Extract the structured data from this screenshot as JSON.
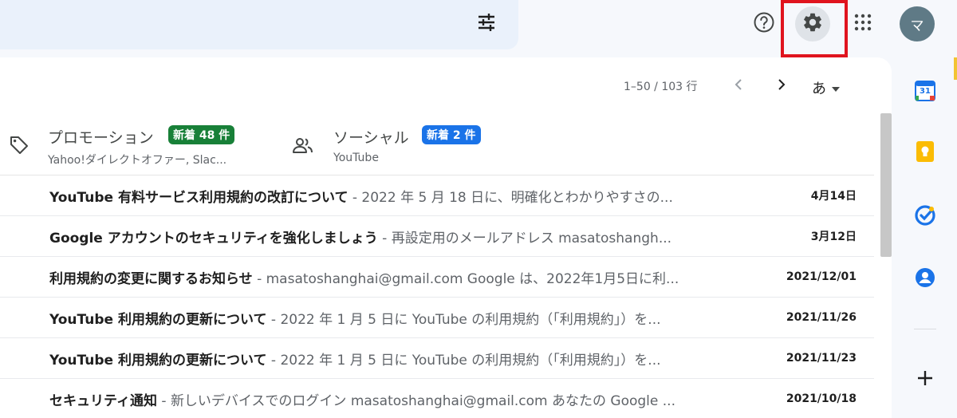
{
  "header": {
    "settings_tooltip": "設定",
    "avatar_initial": "マ"
  },
  "toolbar": {
    "pagination": "1–50 / 103 行",
    "input_tool_char": "あ"
  },
  "tabs": [
    {
      "name": "プロモーション",
      "badge": "新着 48 件",
      "sub": "Yahoo!ダイレクトオファー, Slac...",
      "badge_color": "#188038"
    },
    {
      "name": "ソーシャル",
      "badge": "新着 2 件",
      "sub": "YouTube",
      "badge_color": "#1a73e8"
    }
  ],
  "emails": [
    {
      "sender": "YouTube 有料サービス利用規約の改訂について",
      "snippet": "2022 年 5 月 18 日に、明確化とわかりやすさの...",
      "date": "4月14日"
    },
    {
      "sender": "Google アカウントのセキュリティを強化しましょう",
      "snippet": "再設定用のメールアドレス masatoshangh...",
      "date": "3月12日"
    },
    {
      "sender": "利用規約の変更に関するお知らせ",
      "snippet": "masatoshanghai@gmail.com Google は、2022年1月5日に利...",
      "date": "2021/12/01"
    },
    {
      "sender": "YouTube 利用規約の更新について",
      "snippet": "2022 年 1 月 5 日に YouTube の利用規約（「利用規約」）を...",
      "date": "2021/11/26"
    },
    {
      "sender": "YouTube 利用規約の更新について",
      "snippet": "2022 年 1 月 5 日に YouTube の利用規約（「利用規約」）を...",
      "date": "2021/11/23"
    },
    {
      "sender": "セキュリティ通知",
      "snippet": "新しいデバイスでのログイン masatoshanghai@gmail.com あなたの Google ...",
      "date": "2021/10/18"
    }
  ],
  "side_panel": {
    "calendar_day": "31"
  },
  "colors": {
    "highlight": "#e0141e",
    "calendar": "#1a73e8",
    "keep": "#fbbc04",
    "tasks": "#1a73e8",
    "contacts": "#1a73e8"
  }
}
